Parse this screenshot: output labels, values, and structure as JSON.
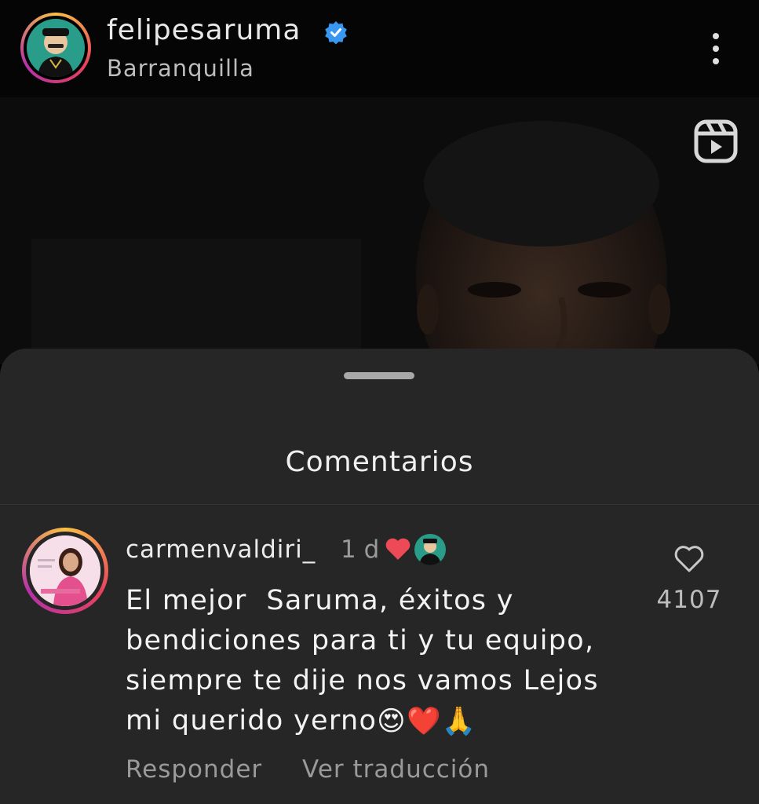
{
  "header": {
    "username": "felipesaruma",
    "location": "Barranquilla",
    "icons": [
      "verified-badge-icon",
      "more-options-icon"
    ]
  },
  "video": {
    "icons": [
      "reels-icon"
    ]
  },
  "sheet": {
    "title": "Comentarios"
  },
  "comment": {
    "username": "carmenvaldiri_",
    "time": "1 d",
    "text": "El mejor  Saruma, éxitos y\nbendiciones para ti y tu equipo,\nsiempre te dije nos vamos Lejos\nmi querido yerno",
    "emojis": "😍❤️🙏",
    "like_count": "4107",
    "reply_label": "Responder",
    "translate_label": "Ver traducción",
    "icons": [
      "heart-outline-icon",
      "liked-by-author-heart-icon"
    ]
  },
  "colors": {
    "background": "#000000",
    "sheet": "#262626",
    "verified": "#3897f0",
    "heart": "#ed4956"
  }
}
